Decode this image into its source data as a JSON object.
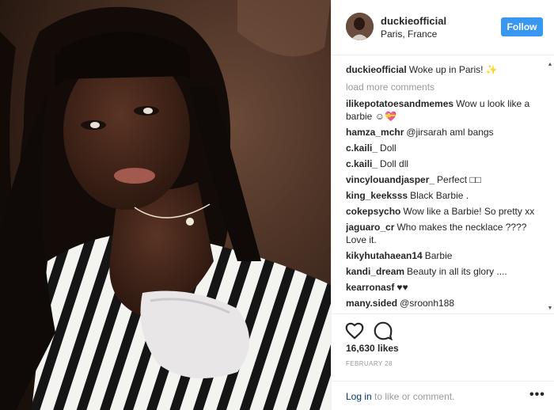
{
  "post": {
    "username": "duckieofficial",
    "location": "Paris, France",
    "follow_label": "Follow",
    "caption_user": "duckieofficial",
    "caption_text": "Woke up in Paris! ✨",
    "load_more": "load more comments",
    "comments": [
      {
        "user": "ilikepotatoesandmemes",
        "text": "Wow u look like a barbie ☺💝"
      },
      {
        "user": "hamza_mchr",
        "text": "@jirsarah aml bangs"
      },
      {
        "user": "c.kaili_",
        "text": "Doll"
      },
      {
        "user": "c.kaili_",
        "text": "Doll dll"
      },
      {
        "user": "vincylouandjasper_",
        "text": "Perfect □□"
      },
      {
        "user": "king_keeksss",
        "text": "Black Barbie ."
      },
      {
        "user": "cokepsycho",
        "text": "Wow like a Barbie! So pretty xx"
      },
      {
        "user": "jaguaro_cr",
        "text": "Who makes the necklace ???? Love it."
      },
      {
        "user": "kikyhutahaean14",
        "text": "Barbie"
      },
      {
        "user": "kandi_dream",
        "text": "Beauty in all its glory ...."
      },
      {
        "user": "kearronasf",
        "text": "♥♥"
      },
      {
        "user": "many.sided",
        "text": "@sroonh188"
      }
    ],
    "likes": "16,630 likes",
    "date": "FEBRUARY 28",
    "login_link": "Log in",
    "login_rest": "to like or comment.",
    "more": "•••"
  },
  "icons": {
    "like": "heart-icon",
    "comment": "comment-bubble-icon",
    "scroll_up": "▲",
    "scroll_down": "▼"
  },
  "colors": {
    "follow_button": "#3897f0",
    "muted_text": "#999999",
    "divider": "#efefef"
  }
}
